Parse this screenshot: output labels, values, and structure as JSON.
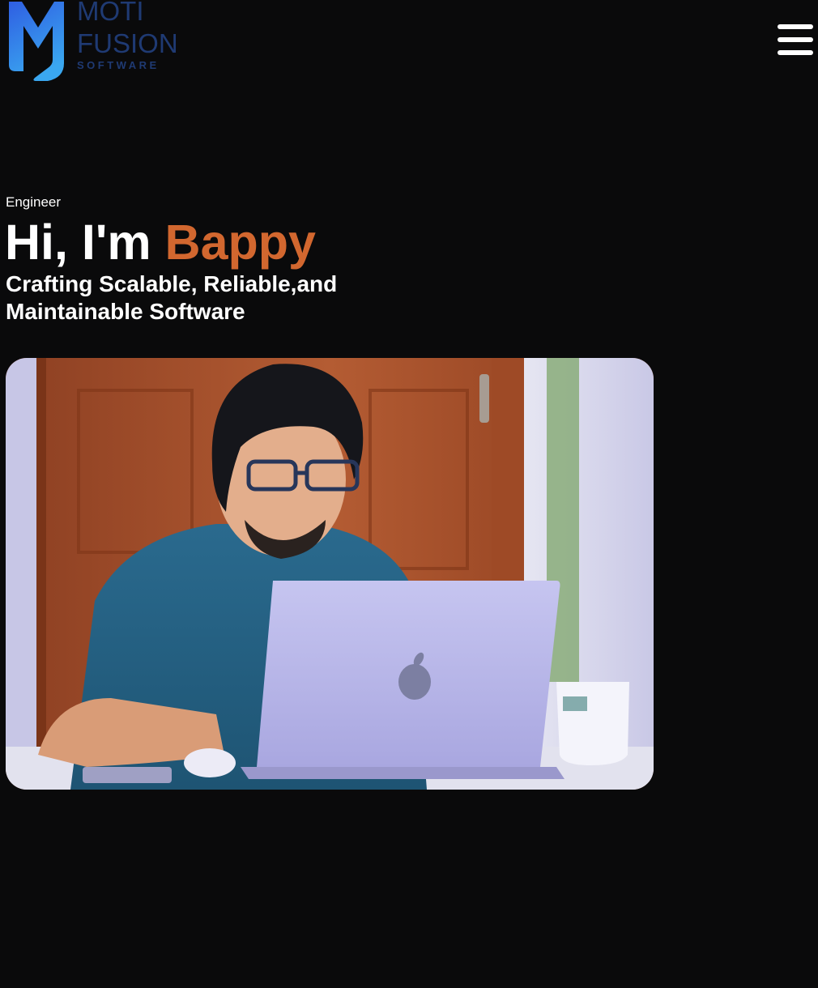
{
  "header": {
    "logo": {
      "line1": "MOTI",
      "line2": "FUSION",
      "line3": "SOFTWARE",
      "icon": "m-monogram-logo",
      "colors": {
        "gradient_top": "#2d5de0",
        "gradient_bottom": "#39a6ef",
        "wordmark": "#1f3a73"
      }
    },
    "menu": {
      "icon": "hamburger-menu-icon"
    }
  },
  "hero": {
    "role": "Engineer",
    "greeting": "Hi, I'm",
    "name": "Bappy",
    "tagline": "Crafting Scalable, Reliable,and Maintainable Software",
    "photo": {
      "icon": "developer-at-laptop-photo"
    }
  },
  "colors": {
    "background": "#0a0a0b",
    "text": "#ffffff",
    "accent": "#d2672f"
  }
}
